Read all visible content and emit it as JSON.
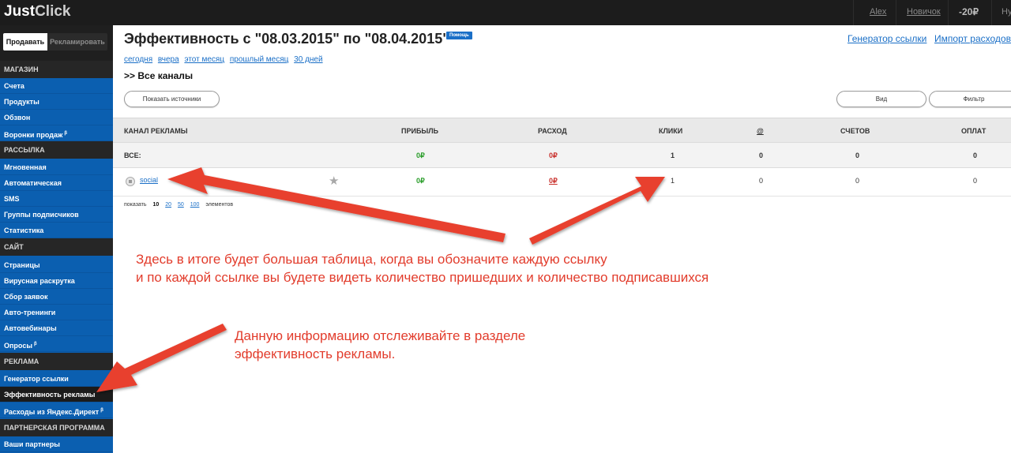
{
  "topbar": {
    "logo_part1": "Just",
    "logo_part2": "Click",
    "user": "Alex",
    "level": "Новичок",
    "balance": "-20₽",
    "cut_text": "Ну"
  },
  "sidebar": {
    "tab_sell": "Продавать",
    "tab_advertise": "Рекламировать",
    "sections": [
      {
        "title": "МАГАЗИН",
        "items": [
          "Счета",
          "Продукты",
          "Обзвон",
          "Воронки продаж"
        ]
      },
      {
        "title": "РАССЫЛКА",
        "items": [
          "Мгновенная",
          "Автоматическая",
          "SMS",
          "Группы подписчиков",
          "Статистика"
        ]
      },
      {
        "title": "САЙТ",
        "items": [
          "Страницы",
          "Вирусная раскрутка",
          "Сбор заявок",
          "Авто-тренинги",
          "Автовебинары",
          "Опросы"
        ]
      },
      {
        "title": "РЕКЛАМА",
        "items": [
          "Генератор ссылки",
          "Эффективность рекламы",
          "Расходы из Яндекс.Директ"
        ]
      },
      {
        "title": "ПАРТНЕРСКАЯ ПРОГРАММА",
        "items": [
          "Ваши партнеры"
        ]
      }
    ],
    "beta_mark": "β"
  },
  "main": {
    "title": "Эффективность с  \"08.03.2015\" по \"08.04.2015\"",
    "help": "Помощь",
    "link_generator": "Генератор ссылки",
    "link_import": "Импорт расходов",
    "date_links": [
      "сегодня",
      "вчера",
      "этот месяц",
      "прошлый месяц",
      "30 дней"
    ],
    "breadcrumb": ">> Все каналы",
    "btn_sources": "Показать источники",
    "btn_view": "Вид",
    "btn_filter": "Фильтр"
  },
  "table": {
    "headers": [
      "КАНАЛ РЕКЛАМЫ",
      "ПРИБЫЛЬ",
      "РАСХОД",
      "КЛИКИ",
      "@",
      "СЧЕТОВ",
      "ОПЛАТ"
    ],
    "total": {
      "label": "ВСЕ:",
      "profit": "0₽",
      "expense": "0₽",
      "clicks": "1",
      "at": "0",
      "invoices": "0",
      "payments": "0"
    },
    "rows": [
      {
        "channel": "social",
        "profit": "0₽",
        "expense": "0₽",
        "clicks": "1",
        "at": "0",
        "invoices": "0",
        "payments": "0"
      }
    ]
  },
  "pager": {
    "label": "показать",
    "current": "10",
    "options": [
      "20",
      "50",
      "100"
    ],
    "suffix": "элементов"
  },
  "annotations": {
    "note1_line1": "Здесь в итоге будет большая таблица, когда вы обозначите каждую ссылку",
    "note1_line2": "и по каждой ссылке вы будете видеть количество пришедших и количество подписавшихся",
    "note2_line1": "Данную информацию отслеживайте в разделе",
    "note2_line2": "эффективность рекламы.",
    "color": "#e23c2c"
  }
}
